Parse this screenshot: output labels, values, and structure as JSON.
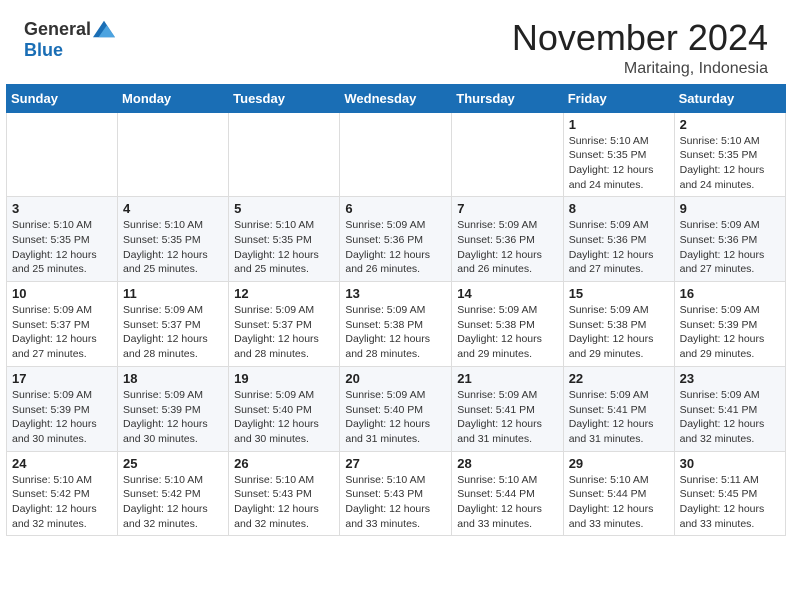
{
  "header": {
    "logo_general": "General",
    "logo_blue": "Blue",
    "month_title": "November 2024",
    "location": "Maritaing, Indonesia"
  },
  "weekdays": [
    "Sunday",
    "Monday",
    "Tuesday",
    "Wednesday",
    "Thursday",
    "Friday",
    "Saturday"
  ],
  "weeks": [
    [
      {
        "day": "",
        "info": ""
      },
      {
        "day": "",
        "info": ""
      },
      {
        "day": "",
        "info": ""
      },
      {
        "day": "",
        "info": ""
      },
      {
        "day": "",
        "info": ""
      },
      {
        "day": "1",
        "info": "Sunrise: 5:10 AM\nSunset: 5:35 PM\nDaylight: 12 hours and 24 minutes."
      },
      {
        "day": "2",
        "info": "Sunrise: 5:10 AM\nSunset: 5:35 PM\nDaylight: 12 hours and 24 minutes."
      }
    ],
    [
      {
        "day": "3",
        "info": "Sunrise: 5:10 AM\nSunset: 5:35 PM\nDaylight: 12 hours and 25 minutes."
      },
      {
        "day": "4",
        "info": "Sunrise: 5:10 AM\nSunset: 5:35 PM\nDaylight: 12 hours and 25 minutes."
      },
      {
        "day": "5",
        "info": "Sunrise: 5:10 AM\nSunset: 5:35 PM\nDaylight: 12 hours and 25 minutes."
      },
      {
        "day": "6",
        "info": "Sunrise: 5:09 AM\nSunset: 5:36 PM\nDaylight: 12 hours and 26 minutes."
      },
      {
        "day": "7",
        "info": "Sunrise: 5:09 AM\nSunset: 5:36 PM\nDaylight: 12 hours and 26 minutes."
      },
      {
        "day": "8",
        "info": "Sunrise: 5:09 AM\nSunset: 5:36 PM\nDaylight: 12 hours and 27 minutes."
      },
      {
        "day": "9",
        "info": "Sunrise: 5:09 AM\nSunset: 5:36 PM\nDaylight: 12 hours and 27 minutes."
      }
    ],
    [
      {
        "day": "10",
        "info": "Sunrise: 5:09 AM\nSunset: 5:37 PM\nDaylight: 12 hours and 27 minutes."
      },
      {
        "day": "11",
        "info": "Sunrise: 5:09 AM\nSunset: 5:37 PM\nDaylight: 12 hours and 28 minutes."
      },
      {
        "day": "12",
        "info": "Sunrise: 5:09 AM\nSunset: 5:37 PM\nDaylight: 12 hours and 28 minutes."
      },
      {
        "day": "13",
        "info": "Sunrise: 5:09 AM\nSunset: 5:38 PM\nDaylight: 12 hours and 28 minutes."
      },
      {
        "day": "14",
        "info": "Sunrise: 5:09 AM\nSunset: 5:38 PM\nDaylight: 12 hours and 29 minutes."
      },
      {
        "day": "15",
        "info": "Sunrise: 5:09 AM\nSunset: 5:38 PM\nDaylight: 12 hours and 29 minutes."
      },
      {
        "day": "16",
        "info": "Sunrise: 5:09 AM\nSunset: 5:39 PM\nDaylight: 12 hours and 29 minutes."
      }
    ],
    [
      {
        "day": "17",
        "info": "Sunrise: 5:09 AM\nSunset: 5:39 PM\nDaylight: 12 hours and 30 minutes."
      },
      {
        "day": "18",
        "info": "Sunrise: 5:09 AM\nSunset: 5:39 PM\nDaylight: 12 hours and 30 minutes."
      },
      {
        "day": "19",
        "info": "Sunrise: 5:09 AM\nSunset: 5:40 PM\nDaylight: 12 hours and 30 minutes."
      },
      {
        "day": "20",
        "info": "Sunrise: 5:09 AM\nSunset: 5:40 PM\nDaylight: 12 hours and 31 minutes."
      },
      {
        "day": "21",
        "info": "Sunrise: 5:09 AM\nSunset: 5:41 PM\nDaylight: 12 hours and 31 minutes."
      },
      {
        "day": "22",
        "info": "Sunrise: 5:09 AM\nSunset: 5:41 PM\nDaylight: 12 hours and 31 minutes."
      },
      {
        "day": "23",
        "info": "Sunrise: 5:09 AM\nSunset: 5:41 PM\nDaylight: 12 hours and 32 minutes."
      }
    ],
    [
      {
        "day": "24",
        "info": "Sunrise: 5:10 AM\nSunset: 5:42 PM\nDaylight: 12 hours and 32 minutes."
      },
      {
        "day": "25",
        "info": "Sunrise: 5:10 AM\nSunset: 5:42 PM\nDaylight: 12 hours and 32 minutes."
      },
      {
        "day": "26",
        "info": "Sunrise: 5:10 AM\nSunset: 5:43 PM\nDaylight: 12 hours and 32 minutes."
      },
      {
        "day": "27",
        "info": "Sunrise: 5:10 AM\nSunset: 5:43 PM\nDaylight: 12 hours and 33 minutes."
      },
      {
        "day": "28",
        "info": "Sunrise: 5:10 AM\nSunset: 5:44 PM\nDaylight: 12 hours and 33 minutes."
      },
      {
        "day": "29",
        "info": "Sunrise: 5:10 AM\nSunset: 5:44 PM\nDaylight: 12 hours and 33 minutes."
      },
      {
        "day": "30",
        "info": "Sunrise: 5:11 AM\nSunset: 5:45 PM\nDaylight: 12 hours and 33 minutes."
      }
    ]
  ]
}
